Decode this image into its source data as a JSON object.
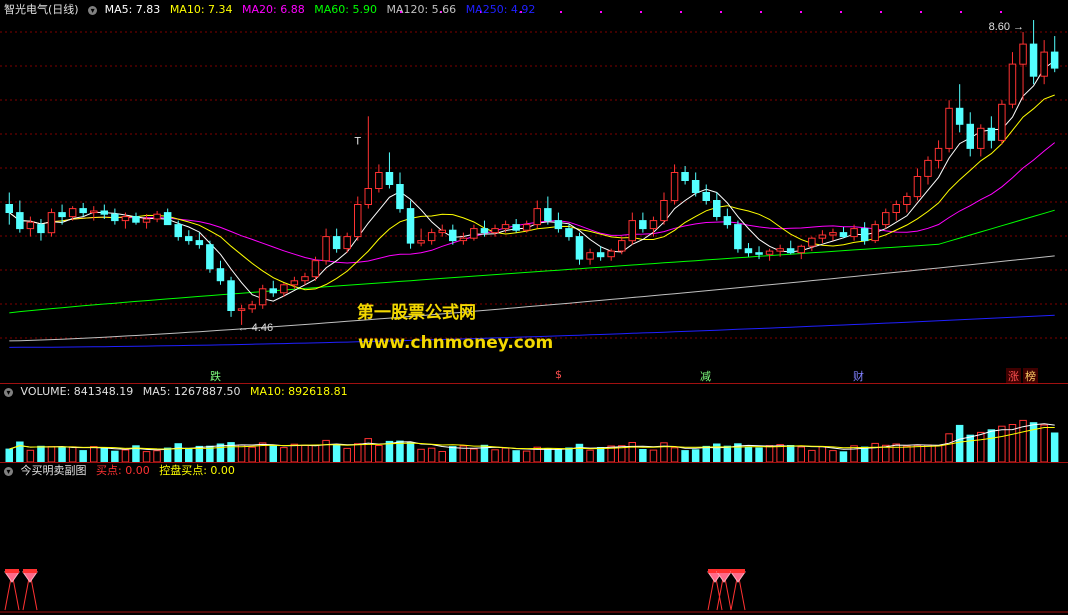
{
  "price_legend": {
    "title": "智光电气(日线)",
    "ma5": "MA5: 7.83",
    "ma10": "MA10: 7.34",
    "ma20": "MA20: 6.88",
    "ma60": "MA60: 5.90",
    "ma120": "MA120: 5.66",
    "ma250": "MA250: 4.92"
  },
  "price_annotations": {
    "high_label": "8.60",
    "low_label": "4.46",
    "t_marker": "T"
  },
  "watermark": {
    "line1": "第一股票公式网",
    "line2": "www.chnmoney.com"
  },
  "event_tags": [
    "跌",
    "$",
    "减",
    "财",
    "涨",
    "榜"
  ],
  "volume_legend": {
    "volume": "VOLUME: 841348.19",
    "ma5": "MA5: 1267887.50",
    "ma10": "MA10: 892618.81"
  },
  "indicator_legend": {
    "title": "今买明卖副图",
    "buy": "买点: 0.00",
    "control": "控盘买点: 0.00"
  },
  "colors": {
    "up": "#ff3232",
    "down": "#54ffff",
    "ma5": "#ffffff",
    "ma10": "#ffff00",
    "ma20": "#ff00ff",
    "ma60": "#00ff00",
    "ma120": "#c0c0c0",
    "ma250": "#2020ff",
    "grid": "#800000"
  },
  "chart_data": {
    "type": "candlestick",
    "price_range": [
      4.3,
      8.7
    ],
    "candles": [
      {
        "o": 6.3,
        "h": 6.45,
        "l": 6.05,
        "c": 6.2
      },
      {
        "o": 6.2,
        "h": 6.35,
        "l": 5.95,
        "c": 6.0
      },
      {
        "o": 6.0,
        "h": 6.15,
        "l": 5.9,
        "c": 6.08
      },
      {
        "o": 6.05,
        "h": 6.12,
        "l": 5.85,
        "c": 5.95
      },
      {
        "o": 5.95,
        "h": 6.25,
        "l": 5.9,
        "c": 6.2
      },
      {
        "o": 6.2,
        "h": 6.3,
        "l": 6.05,
        "c": 6.15
      },
      {
        "o": 6.15,
        "h": 6.28,
        "l": 6.1,
        "c": 6.25
      },
      {
        "o": 6.25,
        "h": 6.32,
        "l": 6.15,
        "c": 6.2
      },
      {
        "o": 6.2,
        "h": 6.28,
        "l": 6.1,
        "c": 6.22
      },
      {
        "o": 6.22,
        "h": 6.3,
        "l": 6.12,
        "c": 6.18
      },
      {
        "o": 6.18,
        "h": 6.25,
        "l": 6.05,
        "c": 6.1
      },
      {
        "o": 6.1,
        "h": 6.2,
        "l": 6.0,
        "c": 6.15
      },
      {
        "o": 6.15,
        "h": 6.2,
        "l": 6.05,
        "c": 6.08
      },
      {
        "o": 6.08,
        "h": 6.18,
        "l": 6.0,
        "c": 6.12
      },
      {
        "o": 6.12,
        "h": 6.22,
        "l": 6.08,
        "c": 6.18
      },
      {
        "o": 6.2,
        "h": 6.25,
        "l": 6.05,
        "c": 6.05
      },
      {
        "o": 6.05,
        "h": 6.1,
        "l": 5.85,
        "c": 5.9
      },
      {
        "o": 5.9,
        "h": 5.98,
        "l": 5.8,
        "c": 5.85
      },
      {
        "o": 5.85,
        "h": 5.95,
        "l": 5.75,
        "c": 5.8
      },
      {
        "o": 5.8,
        "h": 5.85,
        "l": 5.45,
        "c": 5.5
      },
      {
        "o": 5.5,
        "h": 5.6,
        "l": 5.3,
        "c": 5.35
      },
      {
        "o": 5.35,
        "h": 5.4,
        "l": 4.9,
        "c": 4.98
      },
      {
        "o": 4.98,
        "h": 5.05,
        "l": 4.8,
        "c": 5.0
      },
      {
        "o": 5.0,
        "h": 5.1,
        "l": 4.95,
        "c": 5.05
      },
      {
        "o": 5.05,
        "h": 5.3,
        "l": 5.0,
        "c": 5.25
      },
      {
        "o": 5.25,
        "h": 5.35,
        "l": 5.15,
        "c": 5.2
      },
      {
        "o": 5.2,
        "h": 5.32,
        "l": 5.15,
        "c": 5.3
      },
      {
        "o": 5.3,
        "h": 5.4,
        "l": 5.25,
        "c": 5.35
      },
      {
        "o": 5.35,
        "h": 5.45,
        "l": 5.3,
        "c": 5.4
      },
      {
        "o": 5.4,
        "h": 5.65,
        "l": 5.35,
        "c": 5.6
      },
      {
        "o": 5.6,
        "h": 6.0,
        "l": 5.55,
        "c": 5.9
      },
      {
        "o": 5.9,
        "h": 6.0,
        "l": 5.7,
        "c": 5.75
      },
      {
        "o": 5.75,
        "h": 5.95,
        "l": 5.7,
        "c": 5.9
      },
      {
        "o": 5.9,
        "h": 6.4,
        "l": 5.85,
        "c": 6.3
      },
      {
        "o": 6.3,
        "h": 7.4,
        "l": 6.25,
        "c": 6.5
      },
      {
        "o": 6.5,
        "h": 6.8,
        "l": 6.45,
        "c": 6.7
      },
      {
        "o": 6.7,
        "h": 6.95,
        "l": 6.5,
        "c": 6.55
      },
      {
        "o": 6.55,
        "h": 6.7,
        "l": 6.2,
        "c": 6.25
      },
      {
        "o": 6.25,
        "h": 6.35,
        "l": 5.75,
        "c": 5.82
      },
      {
        "o": 5.82,
        "h": 6.0,
        "l": 5.78,
        "c": 5.85
      },
      {
        "o": 5.85,
        "h": 6.0,
        "l": 5.8,
        "c": 5.95
      },
      {
        "o": 5.95,
        "h": 6.05,
        "l": 5.9,
        "c": 5.98
      },
      {
        "o": 5.98,
        "h": 6.05,
        "l": 5.8,
        "c": 5.85
      },
      {
        "o": 5.85,
        "h": 5.95,
        "l": 5.8,
        "c": 5.88
      },
      {
        "o": 5.88,
        "h": 6.05,
        "l": 5.85,
        "c": 6.0
      },
      {
        "o": 6.0,
        "h": 6.1,
        "l": 5.9,
        "c": 5.95
      },
      {
        "o": 5.95,
        "h": 6.05,
        "l": 5.9,
        "c": 6.0
      },
      {
        "o": 6.0,
        "h": 6.1,
        "l": 5.95,
        "c": 6.05
      },
      {
        "o": 6.05,
        "h": 6.12,
        "l": 5.95,
        "c": 5.98
      },
      {
        "o": 5.98,
        "h": 6.1,
        "l": 5.95,
        "c": 6.05
      },
      {
        "o": 6.05,
        "h": 6.35,
        "l": 6.0,
        "c": 6.25
      },
      {
        "o": 6.25,
        "h": 6.4,
        "l": 6.05,
        "c": 6.1
      },
      {
        "o": 6.1,
        "h": 6.2,
        "l": 5.95,
        "c": 6.0
      },
      {
        "o": 6.0,
        "h": 6.05,
        "l": 5.85,
        "c": 5.9
      },
      {
        "o": 5.9,
        "h": 5.95,
        "l": 5.55,
        "c": 5.62
      },
      {
        "o": 5.62,
        "h": 5.75,
        "l": 5.55,
        "c": 5.7
      },
      {
        "o": 5.7,
        "h": 5.78,
        "l": 5.6,
        "c": 5.65
      },
      {
        "o": 5.65,
        "h": 5.75,
        "l": 5.6,
        "c": 5.72
      },
      {
        "o": 5.72,
        "h": 5.9,
        "l": 5.68,
        "c": 5.85
      },
      {
        "o": 5.85,
        "h": 6.2,
        "l": 5.8,
        "c": 6.1
      },
      {
        "o": 6.1,
        "h": 6.2,
        "l": 5.95,
        "c": 6.0
      },
      {
        "o": 6.0,
        "h": 6.15,
        "l": 5.9,
        "c": 6.1
      },
      {
        "o": 6.1,
        "h": 6.45,
        "l": 6.05,
        "c": 6.35
      },
      {
        "o": 6.35,
        "h": 6.8,
        "l": 6.3,
        "c": 6.7
      },
      {
        "o": 6.7,
        "h": 6.78,
        "l": 6.55,
        "c": 6.6
      },
      {
        "o": 6.6,
        "h": 6.7,
        "l": 6.4,
        "c": 6.45
      },
      {
        "o": 6.45,
        "h": 6.55,
        "l": 6.3,
        "c": 6.35
      },
      {
        "o": 6.35,
        "h": 6.45,
        "l": 6.1,
        "c": 6.15
      },
      {
        "o": 6.15,
        "h": 6.25,
        "l": 6.0,
        "c": 6.05
      },
      {
        "o": 6.05,
        "h": 6.1,
        "l": 5.7,
        "c": 5.75
      },
      {
        "o": 5.75,
        "h": 5.82,
        "l": 5.65,
        "c": 5.7
      },
      {
        "o": 5.7,
        "h": 5.78,
        "l": 5.62,
        "c": 5.68
      },
      {
        "o": 5.68,
        "h": 5.75,
        "l": 5.6,
        "c": 5.72
      },
      {
        "o": 5.72,
        "h": 5.8,
        "l": 5.65,
        "c": 5.75
      },
      {
        "o": 5.75,
        "h": 5.85,
        "l": 5.68,
        "c": 5.7
      },
      {
        "o": 5.7,
        "h": 5.8,
        "l": 5.62,
        "c": 5.78
      },
      {
        "o": 5.78,
        "h": 5.9,
        "l": 5.72,
        "c": 5.88
      },
      {
        "o": 5.88,
        "h": 5.98,
        "l": 5.82,
        "c": 5.92
      },
      {
        "o": 5.92,
        "h": 6.0,
        "l": 5.85,
        "c": 5.95
      },
      {
        "o": 5.95,
        "h": 6.02,
        "l": 5.88,
        "c": 5.9
      },
      {
        "o": 5.9,
        "h": 6.05,
        "l": 5.85,
        "c": 6.0
      },
      {
        "o": 6.0,
        "h": 6.08,
        "l": 5.8,
        "c": 5.85
      },
      {
        "o": 5.85,
        "h": 6.1,
        "l": 5.82,
        "c": 6.05
      },
      {
        "o": 6.05,
        "h": 6.25,
        "l": 6.0,
        "c": 6.2
      },
      {
        "o": 6.2,
        "h": 6.35,
        "l": 6.1,
        "c": 6.3
      },
      {
        "o": 6.3,
        "h": 6.45,
        "l": 6.2,
        "c": 6.4
      },
      {
        "o": 6.4,
        "h": 6.75,
        "l": 6.35,
        "c": 6.65
      },
      {
        "o": 6.65,
        "h": 6.9,
        "l": 6.55,
        "c": 6.85
      },
      {
        "o": 6.85,
        "h": 7.1,
        "l": 6.75,
        "c": 7.0
      },
      {
        "o": 7.0,
        "h": 7.6,
        "l": 6.95,
        "c": 7.5
      },
      {
        "o": 7.5,
        "h": 7.8,
        "l": 7.2,
        "c": 7.3
      },
      {
        "o": 7.3,
        "h": 7.45,
        "l": 6.9,
        "c": 7.0
      },
      {
        "o": 7.0,
        "h": 7.3,
        "l": 6.9,
        "c": 7.25
      },
      {
        "o": 7.25,
        "h": 7.4,
        "l": 7.0,
        "c": 7.1
      },
      {
        "o": 7.1,
        "h": 7.6,
        "l": 7.05,
        "c": 7.55
      },
      {
        "o": 7.55,
        "h": 8.2,
        "l": 7.5,
        "c": 8.05
      },
      {
        "o": 8.05,
        "h": 8.45,
        "l": 7.6,
        "c": 8.3
      },
      {
        "o": 8.3,
        "h": 8.6,
        "l": 7.8,
        "c": 7.9
      },
      {
        "o": 7.9,
        "h": 8.35,
        "l": 7.8,
        "c": 8.2
      },
      {
        "o": 8.2,
        "h": 8.4,
        "l": 7.95,
        "c": 8.0
      }
    ],
    "volume_range": [
      0,
      2100000
    ]
  }
}
